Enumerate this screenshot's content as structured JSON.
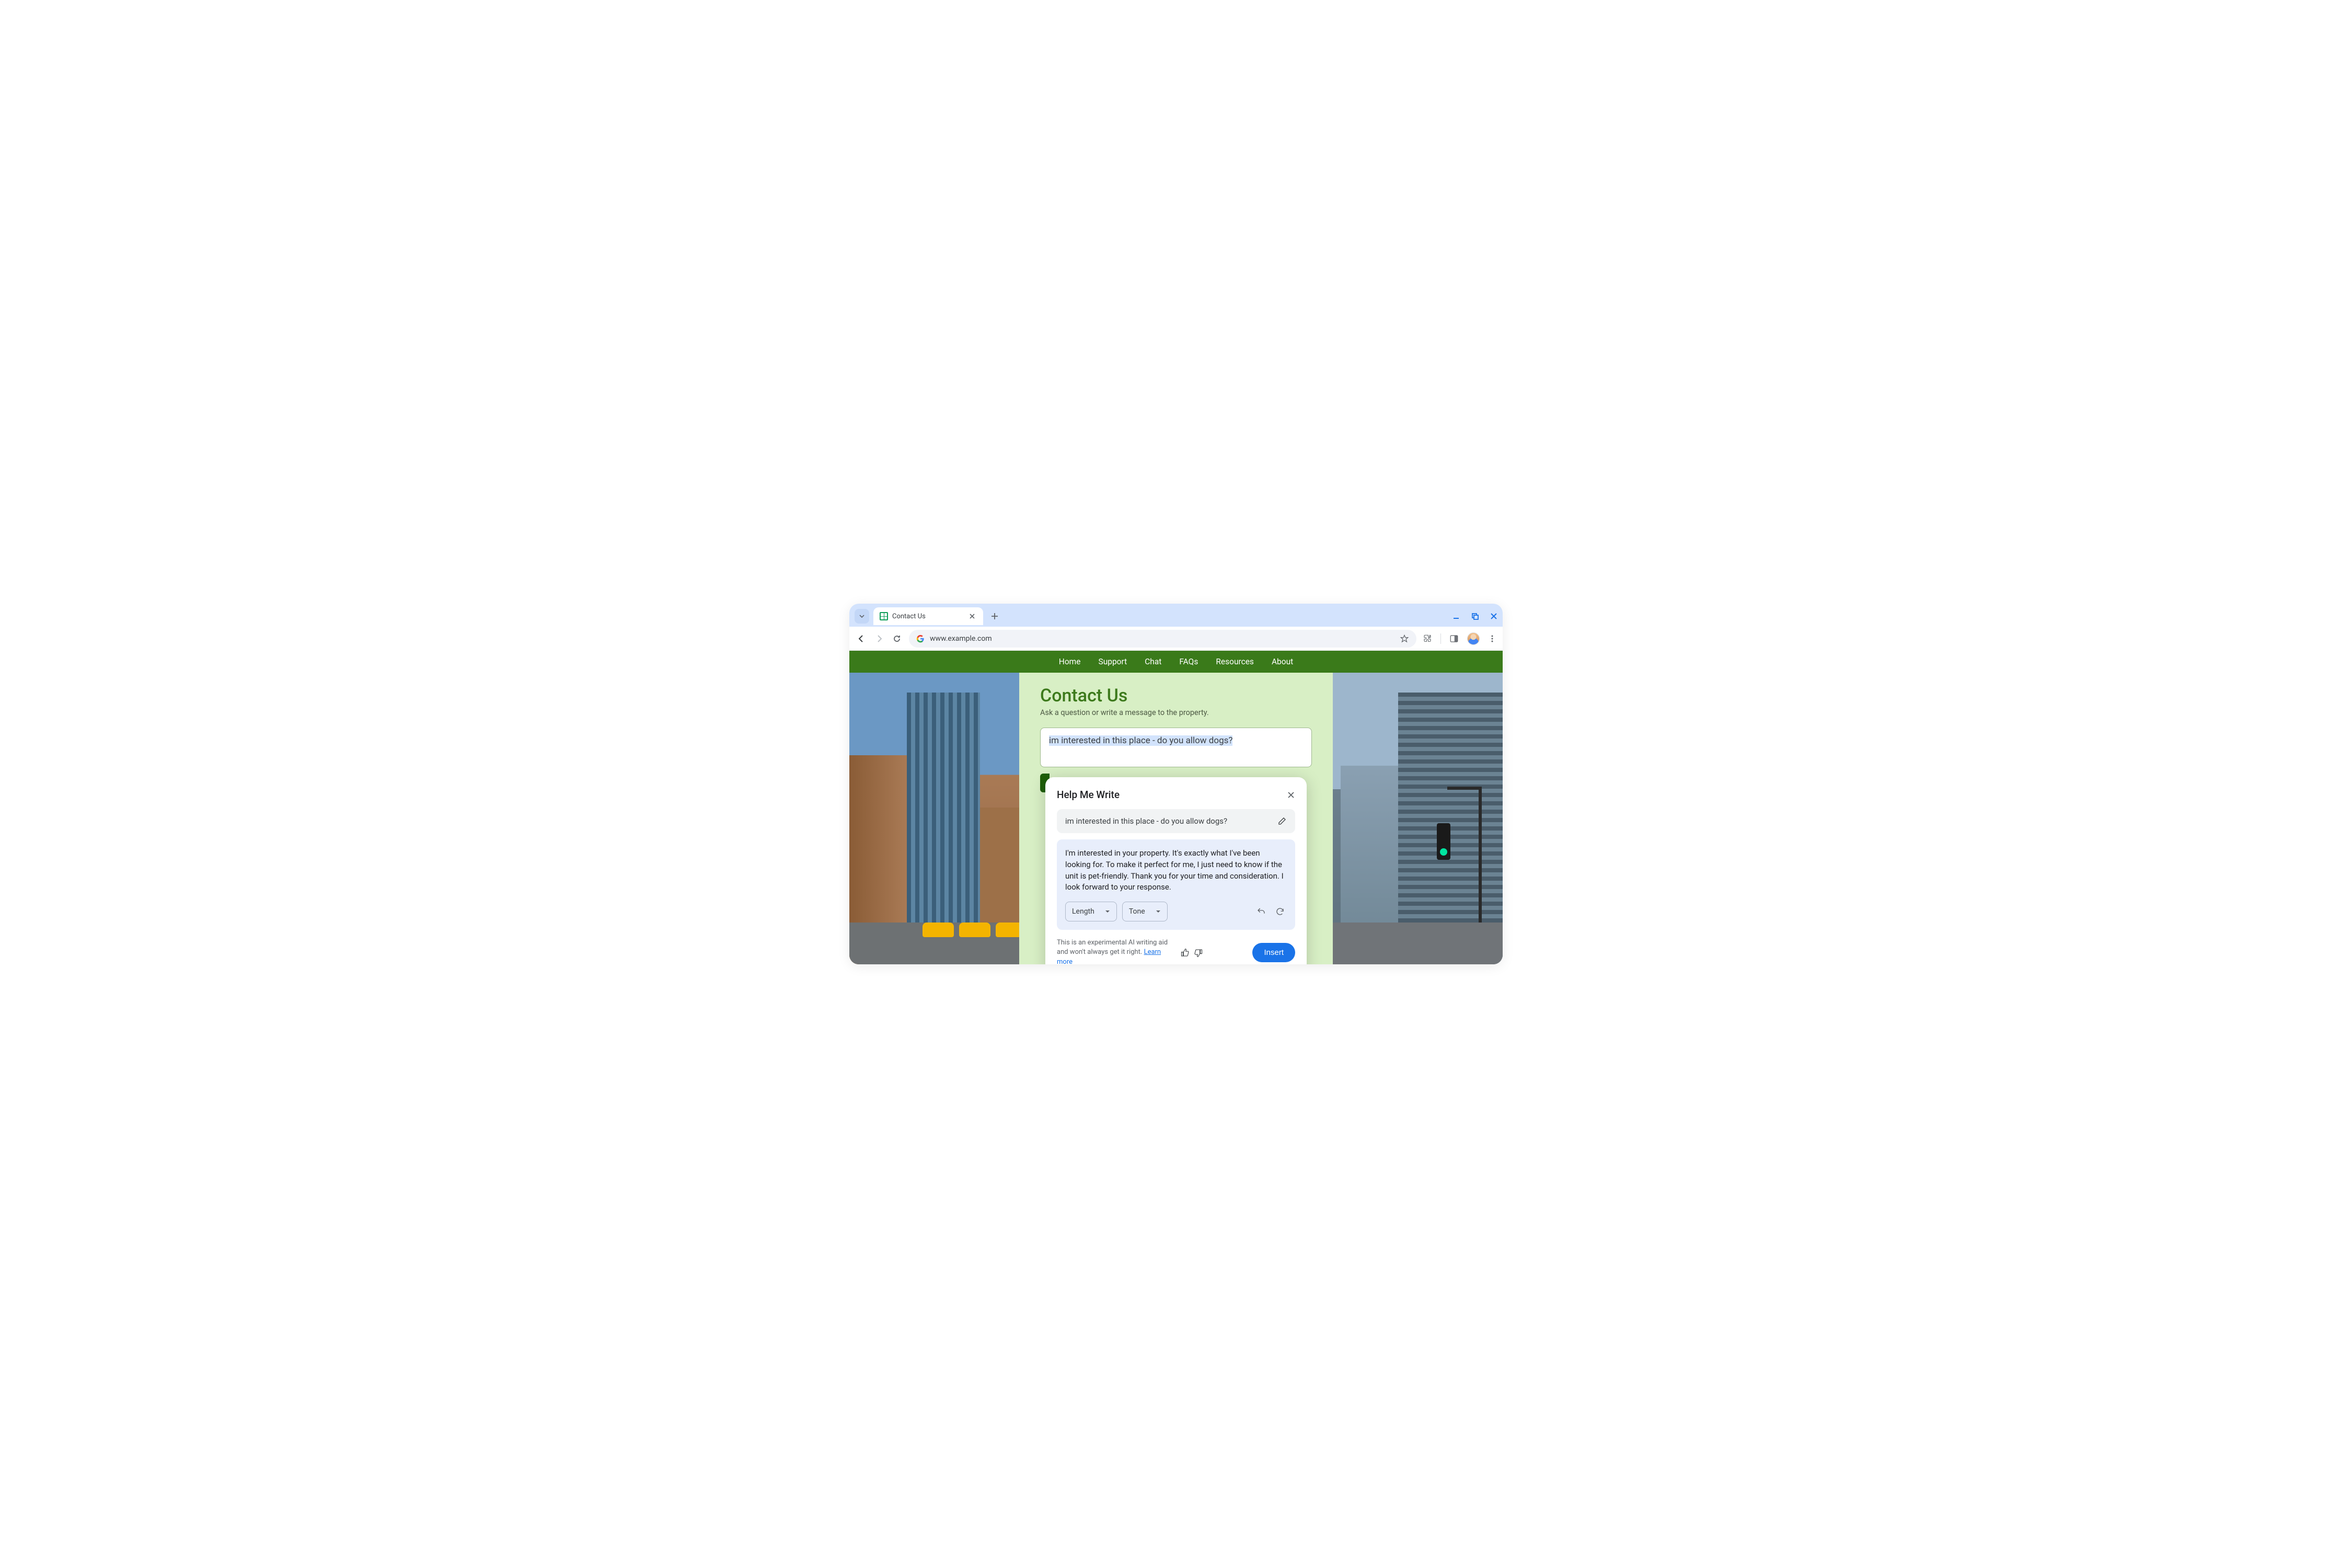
{
  "browser": {
    "tab_title": "Contact Us",
    "url": "www.example.com"
  },
  "nav": {
    "items": [
      "Home",
      "Support",
      "Chat",
      "FAQs",
      "Resources",
      "About"
    ]
  },
  "page": {
    "title": "Contact Us",
    "subtitle": "Ask a question or write a message to the property.",
    "message_text": "im interested in this place - do you allow dogs?"
  },
  "hmw": {
    "title": "Help Me Write",
    "input_text": "im interested in this place - do you allow dogs?",
    "output_text": "I'm interested in your property. It's exactly what I've been looking for. To make it perfect for me, I just need to know if the unit is pet-friendly. Thank you for your time and consideration. I look forward to your response.",
    "length_label": "Length",
    "tone_label": "Tone",
    "disclaimer_text": "This is an experimental AI writing aid and won't always get it right. ",
    "learn_more": "Learn more",
    "insert_label": "Insert"
  }
}
